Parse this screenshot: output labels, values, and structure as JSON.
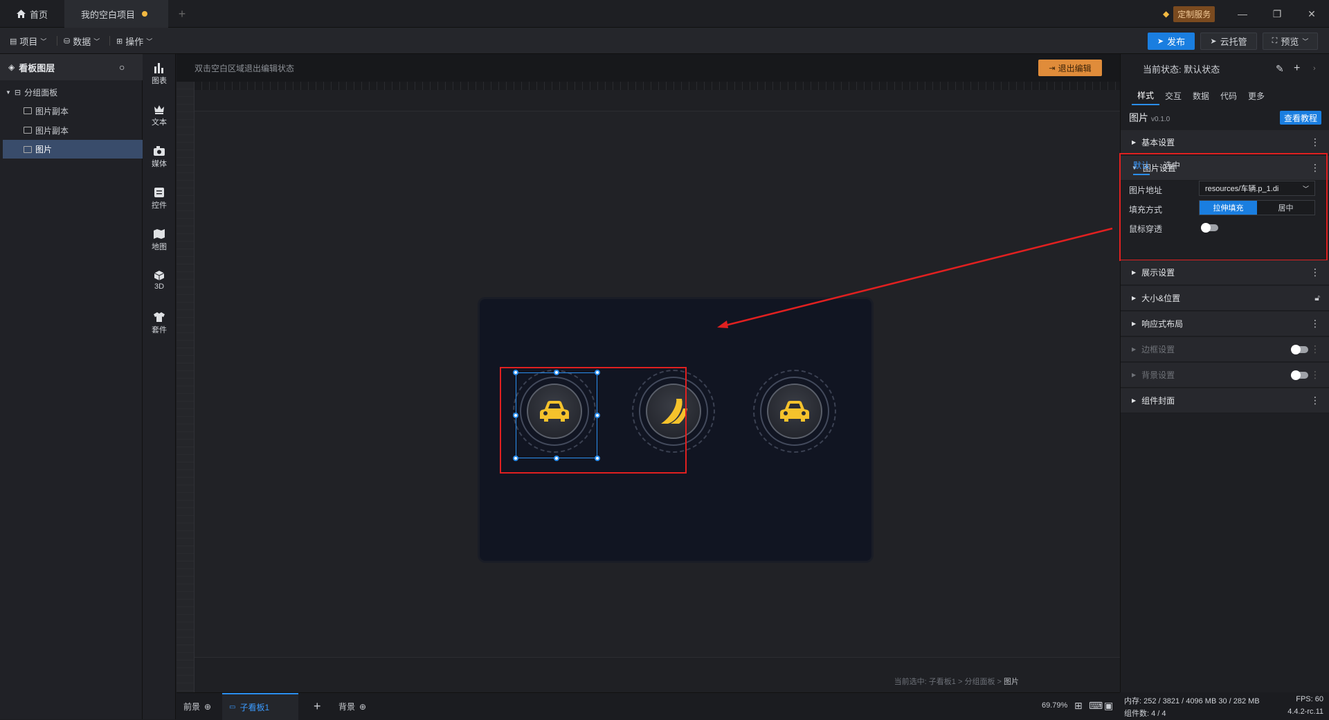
{
  "titlebar": {
    "home_label": "首页",
    "project_label": "我的空白项目",
    "custom_service": "定制服务",
    "add_tab": "+"
  },
  "menubar": {
    "project": "项目",
    "data": "数据",
    "operate": "操作",
    "publish": "发布",
    "cloud": "云托管",
    "preview": "预览"
  },
  "layers": {
    "header": "看板图层",
    "items": [
      {
        "label": "分组面板"
      },
      {
        "label": "图片副本"
      },
      {
        "label": "图片副本"
      },
      {
        "label": "图片"
      }
    ]
  },
  "rail": {
    "items": [
      {
        "label": "图表"
      },
      {
        "label": "文本"
      },
      {
        "label": "媒体"
      },
      {
        "label": "控件"
      },
      {
        "label": "地图"
      },
      {
        "label": "3D"
      },
      {
        "label": "套件"
      }
    ]
  },
  "canvas": {
    "hint": "双击空白区域退出编辑状态",
    "exit_edit": "退出编辑",
    "breadcrumb_prefix": "当前选中: 子看板1 > 分组面板 > ",
    "breadcrumb_current": "图片"
  },
  "bottombar": {
    "foreground": "前景",
    "subboard": "子看板1",
    "add": "+",
    "background": "背景",
    "zoom": "69.79%"
  },
  "status": {
    "memory": "内存: 252 / 3821 / 4096 MB  30 / 282 MB",
    "fps": "FPS: 60",
    "components": "组件数: 4 / 4",
    "version": "4.4.2-rc.11"
  },
  "right": {
    "state": "当前状态: 默认状态",
    "tabs": [
      "样式",
      "交互",
      "数据",
      "代码",
      "更多"
    ],
    "component_name": "图片",
    "component_version": "v0.1.0",
    "tutorial": "查看教程",
    "sections": {
      "basic": "基本设置",
      "image": "图片设置",
      "display": "展示设置",
      "size": "大小&位置",
      "responsive": "响应式布局",
      "border": "边框设置",
      "background": "背景设置",
      "cover": "组件封面"
    },
    "image_settings": {
      "tab_default": "默认",
      "tab_selected": "选中",
      "url_label": "图片地址",
      "url_value": "resources/车辆.p_1.di",
      "fill_label": "填充方式",
      "fill_stretch": "拉伸填充",
      "fill_center": "居中",
      "mouse_label": "鼠标穿透"
    }
  },
  "colors": {
    "accent": "#1a7ee0",
    "highlight": "#e02020",
    "icon_yellow": "#f5c22c"
  }
}
